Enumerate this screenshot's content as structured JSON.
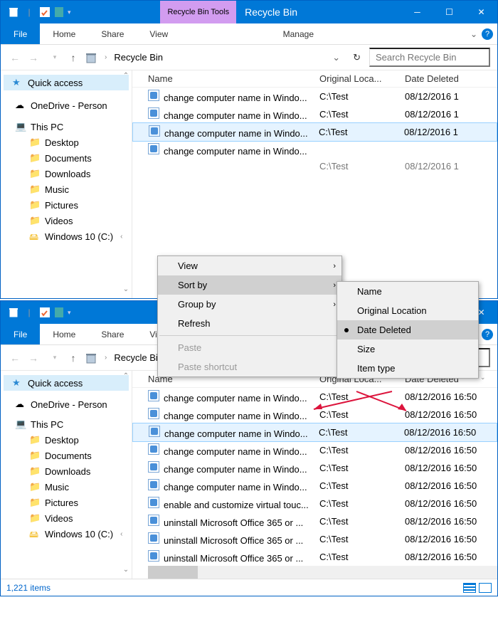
{
  "win": {
    "tools_tab": "Recycle Bin Tools",
    "title": "Recycle Bin",
    "tabs": {
      "file": "File",
      "home": "Home",
      "share": "Share",
      "view": "View",
      "manage": "Manage"
    },
    "breadcrumb": "Recycle Bin",
    "search_ph": "Search Recycle Bin"
  },
  "sidebar": {
    "quick": "Quick access",
    "onedrive": "OneDrive - Person",
    "thispc": "This PC",
    "items": [
      "Desktop",
      "Documents",
      "Downloads",
      "Music",
      "Pictures",
      "Videos",
      "Windows 10 (C:)"
    ]
  },
  "columns": {
    "name": "Name",
    "loc": "Original Loca...",
    "date": "Date Deleted"
  },
  "w1_rows": [
    {
      "name": "change computer name in Windo...",
      "loc": "C:\\Test",
      "date": "08/12/2016 1",
      "hl": false
    },
    {
      "name": "change computer name in Windo...",
      "loc": "C:\\Test",
      "date": "08/12/2016 1",
      "hl": false
    },
    {
      "name": "change computer name in Windo...",
      "loc": "C:\\Test",
      "date": "08/12/2016 1",
      "hl": true
    },
    {
      "name": "change computer name in Windo...",
      "loc": "",
      "date": "",
      "hl": false
    },
    {
      "name": "",
      "loc": "C:\\Test",
      "date": "08/12/2016 1",
      "dim": true
    }
  ],
  "ctx1": {
    "view": "View",
    "sort": "Sort by",
    "group": "Group by",
    "refresh": "Refresh",
    "paste": "Paste",
    "paste_sh": "Paste shortcut"
  },
  "ctx2": [
    "Name",
    "Original Location",
    "Date Deleted",
    "Size",
    "Item type"
  ],
  "ctx2_sel": 2,
  "w2_rows": [
    {
      "name": "change computer name in Windo...",
      "loc": "C:\\Test",
      "date": "08/12/2016 16:50"
    },
    {
      "name": "change computer name in Windo...",
      "loc": "C:\\Test",
      "date": "08/12/2016 16:50"
    },
    {
      "name": "change computer name in Windo...",
      "loc": "C:\\Test",
      "date": "08/12/2016 16:50",
      "hl": true
    },
    {
      "name": "change computer name in Windo...",
      "loc": "C:\\Test",
      "date": "08/12/2016 16:50"
    },
    {
      "name": "change computer name in Windo...",
      "loc": "C:\\Test",
      "date": "08/12/2016 16:50"
    },
    {
      "name": "change computer name in Windo...",
      "loc": "C:\\Test",
      "date": "08/12/2016 16:50"
    },
    {
      "name": "enable and customize virtual touc...",
      "loc": "C:\\Test",
      "date": "08/12/2016 16:50"
    },
    {
      "name": "uninstall Microsoft Office 365 or ...",
      "loc": "C:\\Test",
      "date": "08/12/2016 16:50"
    },
    {
      "name": "uninstall Microsoft Office 365 or ...",
      "loc": "C:\\Test",
      "date": "08/12/2016 16:50"
    },
    {
      "name": "uninstall Microsoft Office 365 or ...",
      "loc": "C:\\Test",
      "date": "08/12/2016 16:50"
    }
  ],
  "status": "1,221 items"
}
